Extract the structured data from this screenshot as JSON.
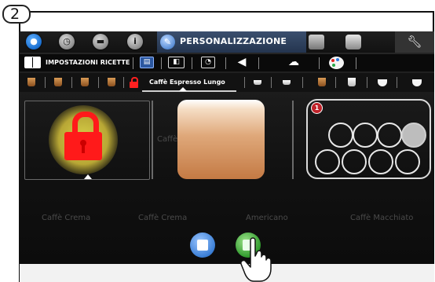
{
  "step": {
    "number": "2"
  },
  "topnav": {
    "icons": [
      "water-drop-icon",
      "clock-icon",
      "folder-icon",
      "info-icon"
    ],
    "active": {
      "icon": "pencil-icon",
      "label": "PERSONALIZZAZIONE"
    },
    "right_icons": [
      "calculator-icon",
      "user-icon",
      "wrench-icon"
    ]
  },
  "recipe_bar": {
    "title": "IMPOSTAZIONI RICETTE",
    "icons": [
      "recipe-book-icon",
      "display-icon",
      "clock-frame-icon",
      "volume-icon",
      "cup-clean-icon",
      "palette-icon"
    ]
  },
  "drink_bar": {
    "selected_label": "Caffè Espresso Lungo",
    "selected_locked": true
  },
  "counter": {
    "badge": "1",
    "total_slots": 8,
    "filled_slots": 1
  },
  "ghost_labels": [
    "Caffè E",
    "Caffè Crema",
    "Caffè Crema",
    "Americano",
    "Caffè Macchiato"
  ],
  "actions": [
    "edit-button",
    "save-button"
  ],
  "colors": {
    "lock": "#ff1a1a",
    "active_tab": "#2b3d5a",
    "edit": "#3b7fd6",
    "save": "#2f9a2c"
  }
}
